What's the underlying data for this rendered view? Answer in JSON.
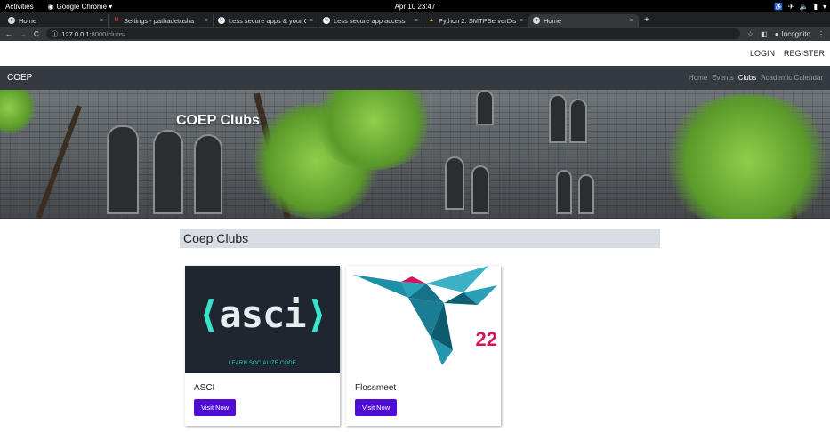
{
  "os": {
    "activities": "Activities",
    "app_name": "Google Chrome ▾",
    "clock": "Apr 10  23:47"
  },
  "browser": {
    "tabs": [
      {
        "title": "Home",
        "active": false,
        "favicon": "globe-icon"
      },
      {
        "title": "Settings - pathadetusha",
        "active": false,
        "favicon": "gmail-icon"
      },
      {
        "title": "Less secure apps & your G",
        "active": false,
        "favicon": "google-icon"
      },
      {
        "title": "Less secure app access",
        "active": false,
        "favicon": "google-icon"
      },
      {
        "title": "Python 2: SMTPServerDis",
        "active": false,
        "favicon": "python-icon"
      },
      {
        "title": "Home",
        "active": true,
        "favicon": "globe-icon"
      }
    ],
    "url_host": "127.0.0.1",
    "url_rest": ":8000/clubs/",
    "incognito_label": "Incognito"
  },
  "header": {
    "login": "LOGIN",
    "register": "REGISTER"
  },
  "navbar": {
    "brand": "COEP",
    "links": [
      "Home",
      "Events",
      "Clubs",
      "Academic Calendar"
    ],
    "active_link": "Clubs"
  },
  "hero": {
    "title": "COEP Clubs"
  },
  "main": {
    "section_title": "Coep Clubs",
    "cards": [
      {
        "name": "ASCI",
        "button": "Visit Now",
        "logo_text": "asci",
        "logo_tagline": "LEARN SOCIALIZE CODE"
      },
      {
        "name": "Flossmeet",
        "button": "Visit Now",
        "logo_text": "22"
      }
    ]
  },
  "colors": {
    "navbar_bg": "#343a40",
    "button_bg": "#4f0dd6",
    "section_bg": "#d7dde3",
    "asci_accent": "#37e4cc",
    "floss_accent": "#d4145a"
  }
}
